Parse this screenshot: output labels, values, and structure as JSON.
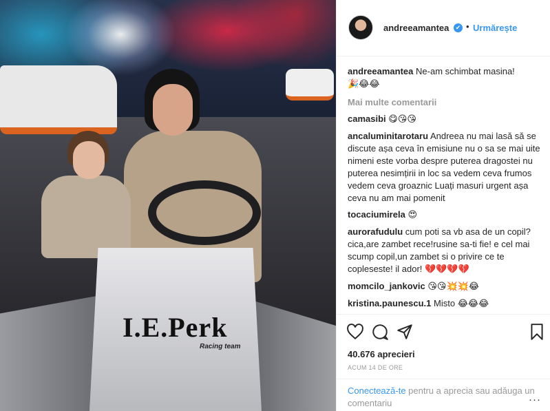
{
  "post": {
    "username": "andreeamantea",
    "follow_label": "Urmărește",
    "separator": "•",
    "verified_glyph": "✔"
  },
  "photo": {
    "kart_logo": "I.E.Perk",
    "kart_tag": "Racing team"
  },
  "comments": [
    {
      "user": "andreeamantea",
      "text": "Ne-am schimbat masina!",
      "emoji": "🎉😂😂"
    },
    {
      "user": "camasibi",
      "text": "",
      "emoji": "😋😘😘"
    },
    {
      "user": "ancaluminitarotaru",
      "text": "Andreea nu mai lasă să se discute așa ceva în emisiune nu o sa se mai uite nimeni este vorba despre puterea dragostei nu puterea nesimțirii in loc sa vedem ceva frumos vedem ceva groaznic Luați masuri urgent așa ceva nu am mai pomenit",
      "emoji": ""
    },
    {
      "user": "tocaciumirela",
      "text": "",
      "emoji": "😍"
    },
    {
      "user": "aurorafudulu",
      "text": "cum poti sa vb asa de un copil?cica,are zambet rece!rusine sa-ti fie! e cel mai scump copil,un zambet si o privire ce te copleseste! il ador!",
      "emoji": "💔💔💔💔"
    },
    {
      "user": "momcilo_jankovic",
      "text": "",
      "emoji": "😘😘💥💥😂"
    },
    {
      "user": "kristina.paunescu.1",
      "text": "Misto",
      "emoji": "😂😂😂"
    }
  ],
  "more_comments_label": "Mai multe comentarii",
  "actions": {
    "likes": "40.676 aprecieri",
    "time": "ACUM 14 DE ORE",
    "icons": [
      "heart-icon",
      "comment-icon",
      "share-icon",
      "bookmark-icon"
    ]
  },
  "login": {
    "link": "Conectează-te",
    "rest": " pentru a aprecia sau adăuga un comentariu",
    "more_glyph": "···"
  },
  "colors": {
    "link": "#3897f0",
    "text": "#262626",
    "muted": "#999999"
  }
}
